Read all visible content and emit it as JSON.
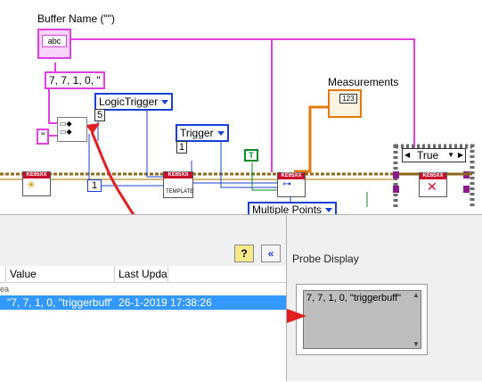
{
  "diagram": {
    "buffer_name_label": "Buffer Name (\"\")",
    "buffer_terminal_text": "abc",
    "string_constant": "7, 7, 1, 0, \"",
    "quote_constant": "\"",
    "logic_trigger_label": "LogicTrigger",
    "logic_trigger_value": "5",
    "trigger_label": "Trigger",
    "trigger_value": "1",
    "index_constant": "1",
    "true_constant": "T",
    "measurements_label": "Measurements",
    "measurements_indicator_text": "123",
    "multiple_points_label": "Multiple Points",
    "case_selector": "True",
    "vi_header": "KE65XX",
    "template_text": "TEMPLATE"
  },
  "probe_list": {
    "help_button": "?",
    "collapse_button": "«",
    "columns": [
      "Value",
      "Last Update"
    ],
    "first_column_cut": "ea",
    "rows": [
      {
        "value": "\"7, 7, 1, 0, \"triggerbuff\"",
        "last_update": "26-1-2019 17:38:26"
      }
    ]
  },
  "probe_display": {
    "title": "Probe Display",
    "value": "7, 7, 1, 0, \"triggerbuff\""
  },
  "colors": {
    "string_wire": "#e040e0",
    "numeric_wire": "#1a3fd6",
    "error_wire": "#8a6a1a",
    "boolean_wire": "#0a8a2a",
    "annotation_arrow": "#e02020",
    "selection": "#3399ff"
  }
}
